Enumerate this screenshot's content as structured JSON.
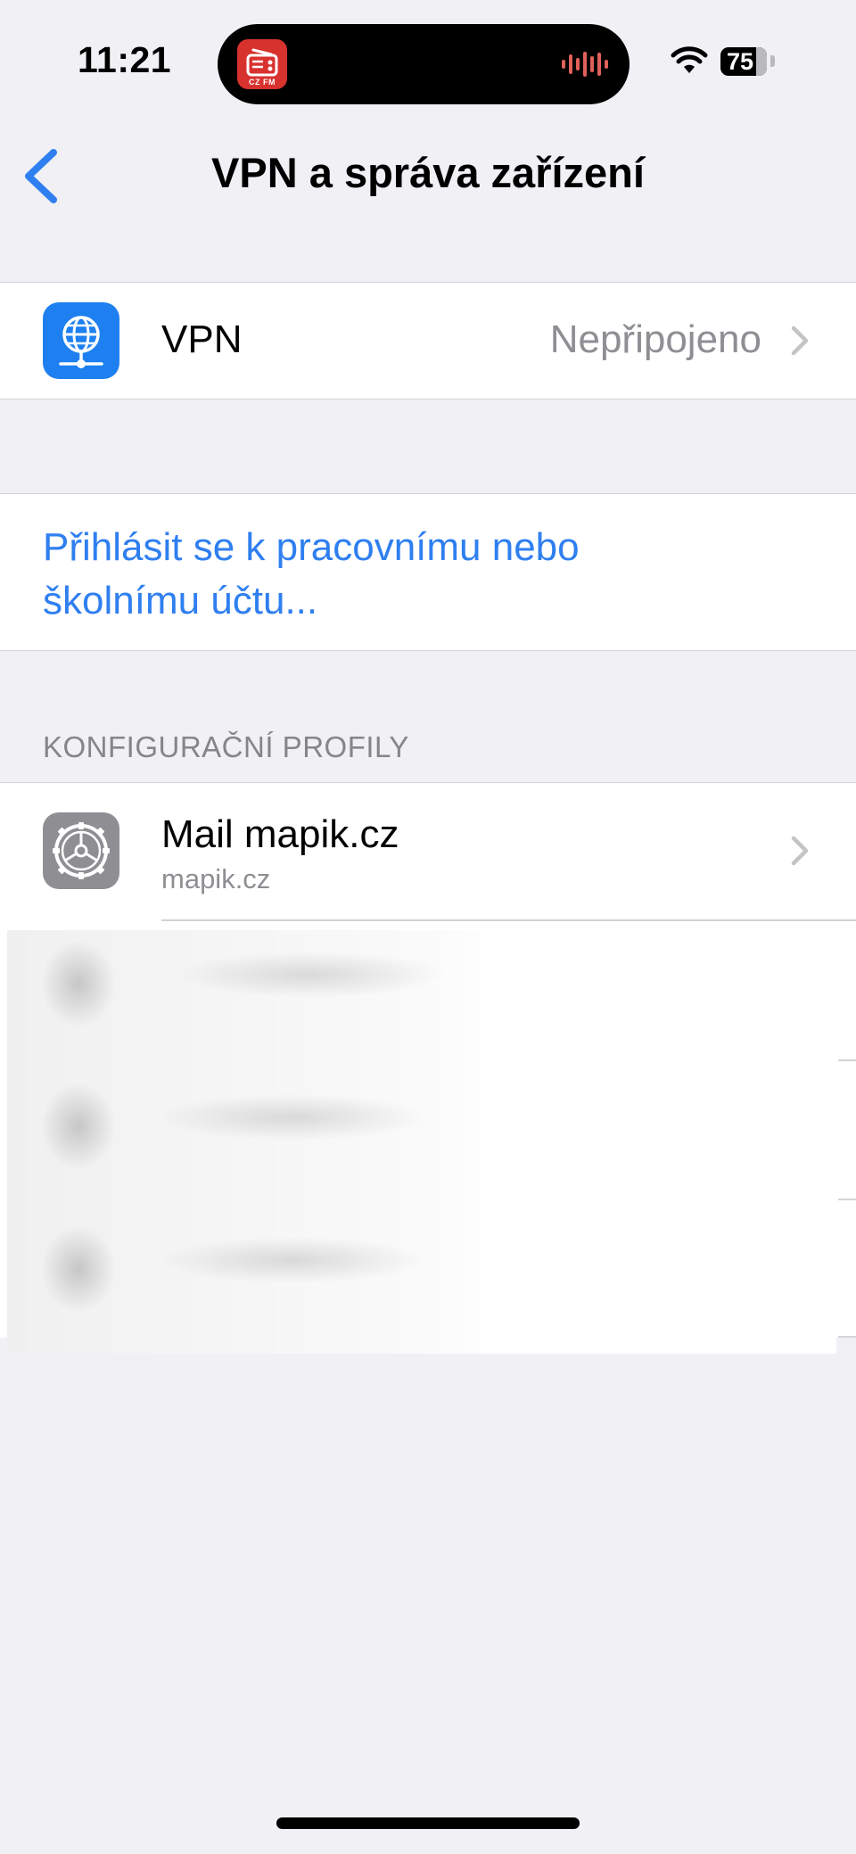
{
  "status_bar": {
    "time": "11:21",
    "battery": "75",
    "now_playing_app_label": "CZ FM"
  },
  "nav": {
    "title": "VPN a správa zařízení"
  },
  "vpn": {
    "label": "VPN",
    "status": "Nepřipojeno"
  },
  "login": {
    "link_text": "Přihlásit se k pracovnímu nebo školnímu účtu..."
  },
  "profiles": {
    "header": "KONFIGURAČNÍ PROFILY",
    "items": [
      {
        "title": "Mail mapik.cz",
        "subtitle": "mapik.cz"
      }
    ]
  },
  "colors": {
    "accent": "#2f7ff0",
    "background": "#f0f0f5",
    "vpn_icon_bg": "#1e80f0",
    "profile_icon_bg": "#8e8e93",
    "secondary_text": "#8e8e93"
  }
}
